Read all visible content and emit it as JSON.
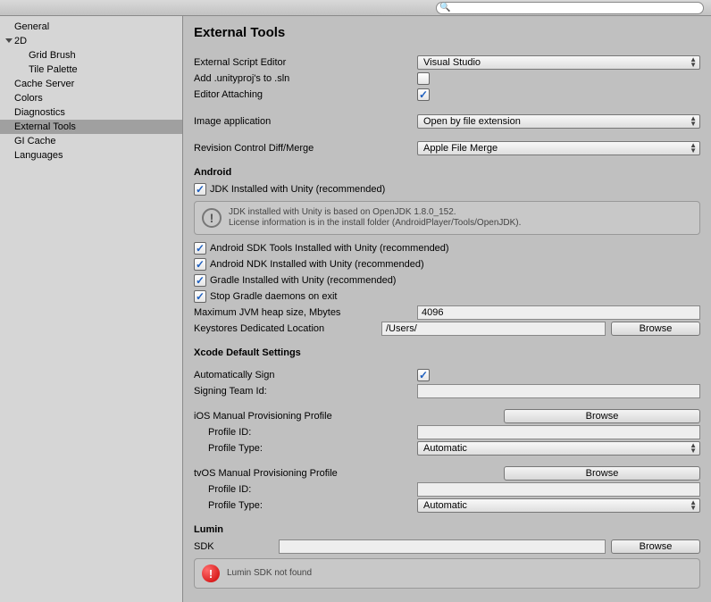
{
  "toolbar": {
    "search_placeholder": ""
  },
  "sidebar": {
    "items": [
      {
        "label": "General"
      },
      {
        "label": "2D",
        "expanded": true
      },
      {
        "label": "Grid Brush"
      },
      {
        "label": "Tile Palette"
      },
      {
        "label": "Cache Server"
      },
      {
        "label": "Colors"
      },
      {
        "label": "Diagnostics"
      },
      {
        "label": "External Tools",
        "selected": true
      },
      {
        "label": "GI Cache"
      },
      {
        "label": "Languages"
      }
    ]
  },
  "page": {
    "title": "External Tools",
    "external_script_editor_label": "External Script Editor",
    "external_script_editor_value": "Visual Studio",
    "add_unityproj_label": "Add .unityproj's to .sln",
    "editor_attaching_label": "Editor Attaching",
    "image_application_label": "Image application",
    "image_application_value": "Open by file extension",
    "revision_control_label": "Revision Control Diff/Merge",
    "revision_control_value": "Apple File Merge"
  },
  "android": {
    "section_label": "Android",
    "jdk_label": "JDK Installed with Unity (recommended)",
    "info_line1": "JDK installed with Unity is based on OpenJDK 1.8.0_152.",
    "info_line2": "License information is in the install folder (AndroidPlayer/Tools/OpenJDK).",
    "sdk_tools_label": "Android SDK Tools Installed with Unity (recommended)",
    "ndk_label": "Android NDK Installed with Unity (recommended)",
    "gradle_label": "Gradle Installed with Unity (recommended)",
    "stop_gradle_label": "Stop Gradle daemons on exit",
    "jvm_heap_label": "Maximum JVM heap size, Mbytes",
    "jvm_heap_value": "4096",
    "keystore_label": "Keystores Dedicated Location",
    "keystore_value": "/Users/",
    "browse_label": "Browse"
  },
  "xcode": {
    "section_label": "Xcode Default Settings",
    "auto_sign_label": "Automatically Sign",
    "signing_team_label": "Signing Team Id:",
    "signing_team_value": "",
    "ios_profile_label": "iOS Manual Provisioning Profile",
    "tvos_profile_label": "tvOS Manual Provisioning Profile",
    "profile_id_label": "Profile ID:",
    "profile_id_value": "",
    "profile_type_label": "Profile Type:",
    "profile_type_value": "Automatic",
    "browse_label": "Browse"
  },
  "lumin": {
    "section_label": "Lumin",
    "sdk_label": "SDK",
    "sdk_value": "",
    "browse_label": "Browse",
    "error_text": "Lumin SDK not found"
  }
}
